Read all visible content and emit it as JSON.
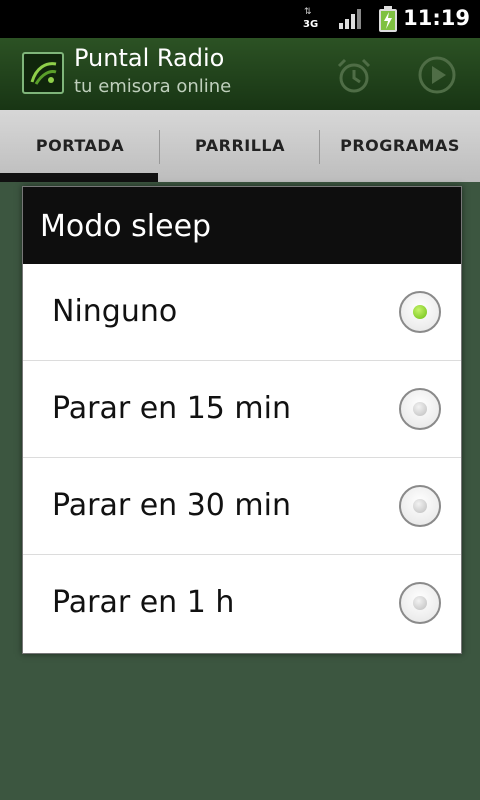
{
  "status_bar": {
    "network_label": "3G",
    "time": "11:19"
  },
  "app": {
    "title": "Puntal Radio",
    "subtitle": "tu emisora online",
    "accent_color": "#7fc142"
  },
  "tabs": [
    {
      "label": "PORTADA",
      "selected": true
    },
    {
      "label": "PARRILLA",
      "selected": false
    },
    {
      "label": "PROGRAMAS",
      "selected": false
    }
  ],
  "dialog": {
    "title": "Modo sleep",
    "options": [
      {
        "label": "Ninguno",
        "checked": true
      },
      {
        "label": "Parar en 15 min",
        "checked": false
      },
      {
        "label": "Parar en 30 min",
        "checked": false
      },
      {
        "label": "Parar en 1 h",
        "checked": false
      }
    ]
  },
  "icons": {
    "header_actions": [
      "alarm-clock-icon",
      "play-icon"
    ],
    "status": [
      "data-arrows-icon",
      "signal-icon",
      "battery-charging-icon"
    ]
  }
}
